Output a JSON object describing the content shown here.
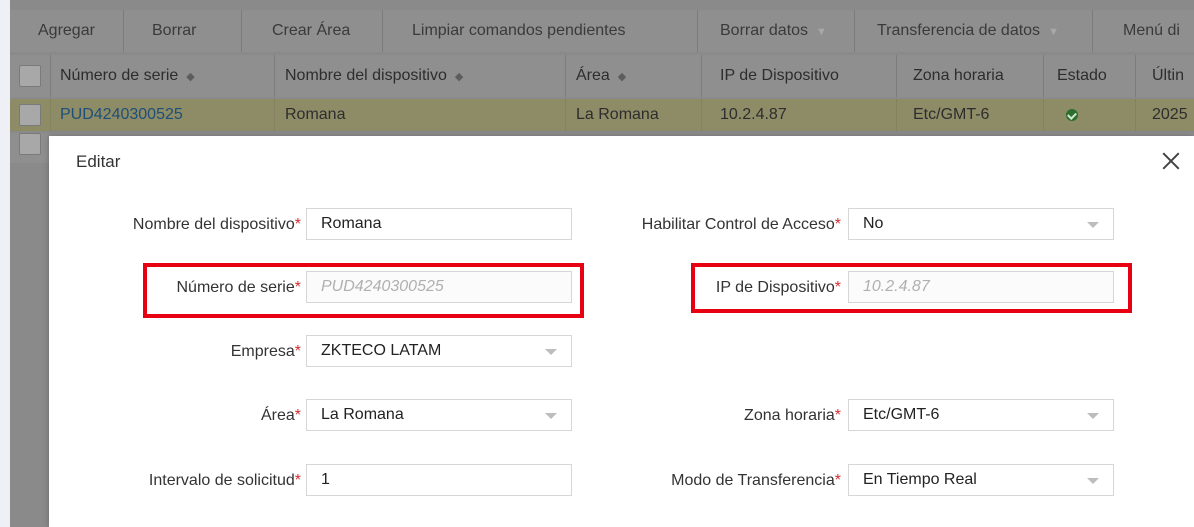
{
  "toolbar": {
    "buttons": [
      {
        "label": "Agregar"
      },
      {
        "label": "Borrar"
      },
      {
        "label": "Crear Área"
      },
      {
        "label": "Limpiar comandos pendientes"
      },
      {
        "label": "Borrar datos"
      },
      {
        "label": "Transferencia de datos"
      },
      {
        "label": "Menú di"
      }
    ]
  },
  "table": {
    "columns": [
      "Número de serie",
      "Nombre del dispositivo",
      "Área",
      "IP de Dispositivo",
      "Zona horaria",
      "Estado",
      "Últin"
    ],
    "rows": [
      {
        "serial": "PUD4240300525",
        "name": "Romana",
        "area": "La Romana",
        "ip": "10.2.4.87",
        "timezone": "Etc/GMT-6",
        "last": "2025"
      }
    ]
  },
  "dialog": {
    "title": "Editar",
    "fields": {
      "device_name": {
        "label": "Nombre del dispositivo",
        "value": "Romana"
      },
      "access_control": {
        "label": "Habilitar Control de Acceso",
        "value": "No"
      },
      "serial": {
        "label": "Número de serie",
        "value": "PUD4240300525"
      },
      "device_ip": {
        "label": "IP de Dispositivo",
        "value": "10.2.4.87"
      },
      "company": {
        "label": "Empresa",
        "value": "ZKTECO LATAM"
      },
      "area": {
        "label": "Área",
        "value": "La Romana"
      },
      "timezone": {
        "label": "Zona horaria",
        "value": "Etc/GMT-6"
      },
      "interval": {
        "label": "Intervalo de solicitud",
        "value": "1"
      },
      "transfer_mode": {
        "label": "Modo de Transferencia",
        "value": "En Tiempo Real"
      }
    },
    "required_mark": "*"
  },
  "colors": {
    "highlight": "#e60012",
    "required": "#d32f2f",
    "link": "#1d4f7a"
  }
}
